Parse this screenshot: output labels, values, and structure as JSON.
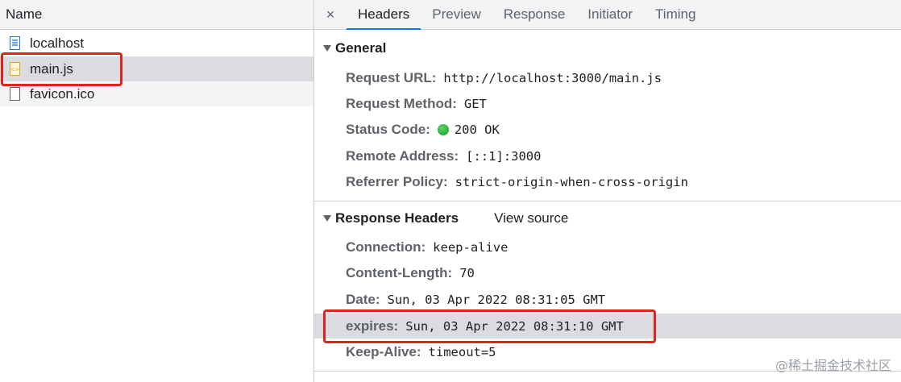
{
  "left_panel": {
    "header": "Name",
    "files": [
      {
        "name": "localhost",
        "icon": "document-icon"
      },
      {
        "name": "main.js",
        "icon": "script-file-icon"
      },
      {
        "name": "favicon.ico",
        "icon": "blank-file-icon"
      }
    ]
  },
  "tabs": {
    "close": "×",
    "items": [
      "Headers",
      "Preview",
      "Response",
      "Initiator",
      "Timing"
    ],
    "active": "Headers"
  },
  "general": {
    "title": "General",
    "rows": [
      {
        "key": "Request URL:",
        "value": "http://localhost:3000/main.js"
      },
      {
        "key": "Request Method:",
        "value": "GET"
      },
      {
        "key": "Status Code:",
        "value": "200 OK",
        "status_color": "#0f9d22"
      },
      {
        "key": "Remote Address:",
        "value": "[::1]:3000"
      },
      {
        "key": "Referrer Policy:",
        "value": "strict-origin-when-cross-origin"
      }
    ]
  },
  "response_headers": {
    "title": "Response Headers",
    "view_source": "View source",
    "rows": [
      {
        "key": "Connection:",
        "value": "keep-alive"
      },
      {
        "key": "Content-Length:",
        "value": "70"
      },
      {
        "key": "Date:",
        "value": "Sun, 03 Apr 2022 08:31:05 GMT"
      },
      {
        "key": "expires:",
        "value": "Sun, 03 Apr 2022 08:31:10 GMT"
      },
      {
        "key": "Keep-Alive:",
        "value": "timeout=5"
      }
    ]
  },
  "watermark": "@稀土掘金技术社区",
  "colors": {
    "highlight_box": "#e3221b",
    "active_tab": "#1a73e8"
  }
}
